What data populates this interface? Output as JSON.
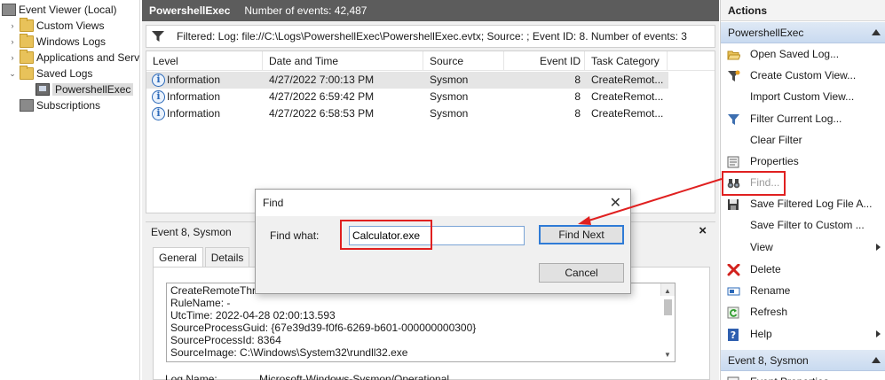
{
  "tree": {
    "items": [
      {
        "label": "Event Viewer (Local)",
        "expander": "",
        "icon": "event-viewer-icon"
      },
      {
        "label": "Custom Views",
        "expander": "›",
        "icon": "folder-icon"
      },
      {
        "label": "Windows Logs",
        "expander": "›",
        "icon": "folder-icon"
      },
      {
        "label": "Applications and Serv",
        "expander": "›",
        "icon": "folder-icon"
      },
      {
        "label": "Saved Logs",
        "expander": "⌄",
        "icon": "folder-icon"
      },
      {
        "label": "PowershellExec",
        "expander": "",
        "icon": "log-icon"
      },
      {
        "label": "Subscriptions",
        "expander": "",
        "icon": "subscriptions-icon"
      }
    ]
  },
  "header": {
    "title": "PowershellExec",
    "count": "Number of events: 42,487"
  },
  "filter": {
    "text": "Filtered: Log: file://C:\\Logs\\PowershellExec\\PowershellExec.evtx; Source: ; Event ID: 8. Number of events: 3"
  },
  "table": {
    "columns": [
      "Level",
      "Date and Time",
      "Source",
      "Event ID",
      "Task Category"
    ],
    "rows": [
      {
        "level": "Information",
        "date": "4/27/2022 7:00:13 PM",
        "source": "Sysmon",
        "id": "8",
        "task": "CreateRemot..."
      },
      {
        "level": "Information",
        "date": "4/27/2022 6:59:42 PM",
        "source": "Sysmon",
        "id": "8",
        "task": "CreateRemot..."
      },
      {
        "level": "Information",
        "date": "4/27/2022 6:58:53 PM",
        "source": "Sysmon",
        "id": "8",
        "task": "CreateRemot..."
      }
    ]
  },
  "detail": {
    "title": "Event 8, Sysmon",
    "close": "×",
    "tabs": [
      "General",
      "Details"
    ],
    "lines": [
      "CreateRemoteThread detected:",
      "RuleName: -",
      "UtcTime: 2022-04-28 02:00:13.593",
      "SourceProcessGuid: {67e39d39-f0f6-6269-b601-000000000300}",
      "SourceProcessId: 8364",
      "SourceImage: C:\\Windows\\System32\\rundll32.exe"
    ],
    "logname_label": "Log Name:",
    "logname_value": "Microsoft-Windows-Sysmon/Operational"
  },
  "dialog": {
    "title": "Find",
    "close": "✕",
    "label": "Find what:",
    "value": "Calculator.exe",
    "find_next": "Find Next",
    "cancel": "Cancel"
  },
  "actions": {
    "title": "Actions",
    "group1": "PowershellExec",
    "items": [
      {
        "label": "Open Saved Log...",
        "icon": "open-folder-icon",
        "submenu": false,
        "disabled": false
      },
      {
        "label": "Create Custom View...",
        "icon": "filter-icon",
        "submenu": false,
        "disabled": false
      },
      {
        "label": "Import Custom View...",
        "icon": "",
        "submenu": false,
        "disabled": false
      },
      {
        "label": "Filter Current Log...",
        "icon": "filter-icon",
        "submenu": false,
        "disabled": false
      },
      {
        "label": "Clear Filter",
        "icon": "",
        "submenu": false,
        "disabled": false
      },
      {
        "label": "Properties",
        "icon": "properties-icon",
        "submenu": false,
        "disabled": false
      },
      {
        "label": "Find...",
        "icon": "binoculars-icon",
        "submenu": false,
        "disabled": true
      },
      {
        "label": "Save Filtered Log File A...",
        "icon": "save-icon",
        "submenu": false,
        "disabled": false
      },
      {
        "label": "Save Filter to Custom ...",
        "icon": "",
        "submenu": false,
        "disabled": false
      },
      {
        "label": "View",
        "icon": "",
        "submenu": true,
        "disabled": false
      },
      {
        "label": "Delete",
        "icon": "delete-icon",
        "submenu": false,
        "disabled": false
      },
      {
        "label": "Rename",
        "icon": "rename-icon",
        "submenu": false,
        "disabled": false
      },
      {
        "label": "Refresh",
        "icon": "refresh-icon",
        "submenu": false,
        "disabled": false
      },
      {
        "label": "Help",
        "icon": "help-icon",
        "submenu": true,
        "disabled": false
      }
    ],
    "group2": "Event 8, Sysmon",
    "item_partial": "Event Properties"
  },
  "colors": {
    "highlight": "#e02020",
    "header_bg": "#5c5c5c",
    "group_bg": "#c9daf0",
    "accent": "#2f7bd6"
  }
}
